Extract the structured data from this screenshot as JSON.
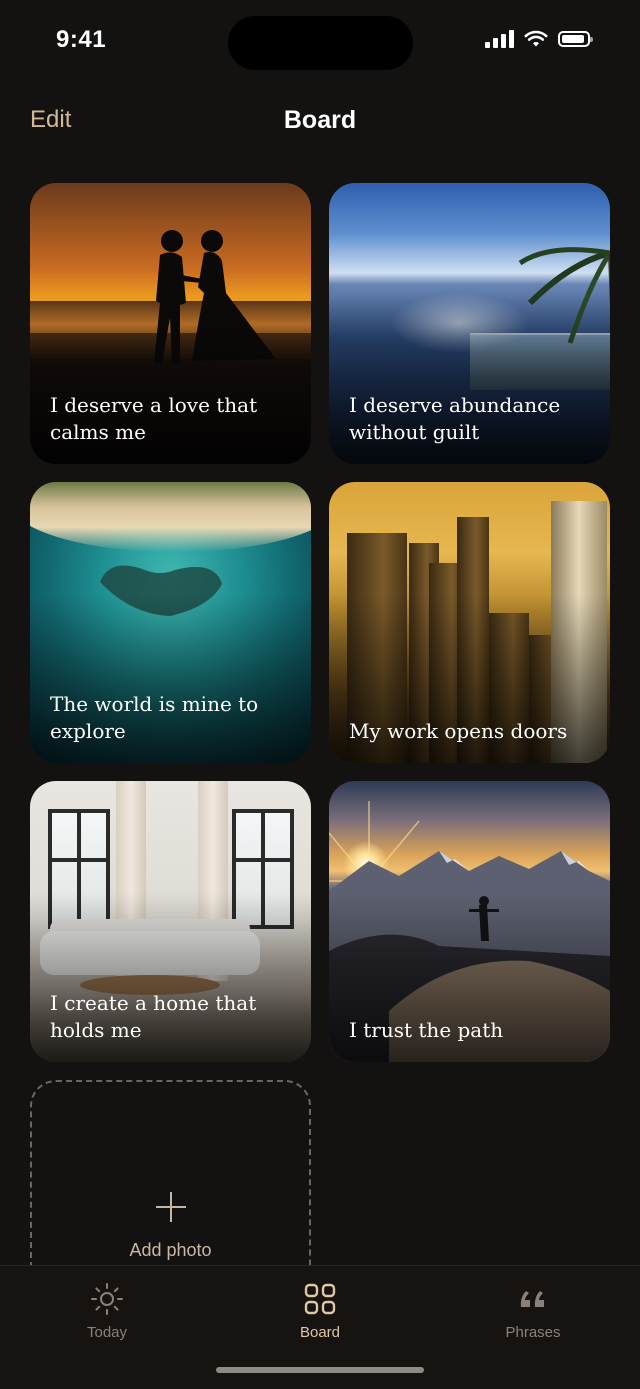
{
  "status_bar": {
    "time": "9:41"
  },
  "header": {
    "edit_label": "Edit",
    "title": "Board"
  },
  "cards": [
    {
      "caption": "I deserve a love that calms me",
      "image": "sunset-couple-image"
    },
    {
      "caption": "I deserve abundance without guilt",
      "image": "infinity-pool-ocean-image"
    },
    {
      "caption": "The world is mine to explore",
      "image": "heart-reef-aerial-image"
    },
    {
      "caption": "My work opens doors",
      "image": "city-skyline-sunrise-image"
    },
    {
      "caption": "I create a home that holds me",
      "image": "bright-living-room-image"
    },
    {
      "caption": "I trust the path",
      "image": "mountain-summit-sunrise-image"
    }
  ],
  "add_tile": {
    "label": "Add photo",
    "icon": "plus-icon"
  },
  "tab_bar": {
    "active": "Board",
    "items": [
      {
        "label": "Today",
        "icon": "sun-icon"
      },
      {
        "label": "Board",
        "icon": "grid-icon"
      },
      {
        "label": "Phrases",
        "icon": "quote-icon"
      }
    ]
  },
  "colors": {
    "accent": "#d2b895",
    "background": "#141211",
    "inactive": "#8a8178"
  }
}
